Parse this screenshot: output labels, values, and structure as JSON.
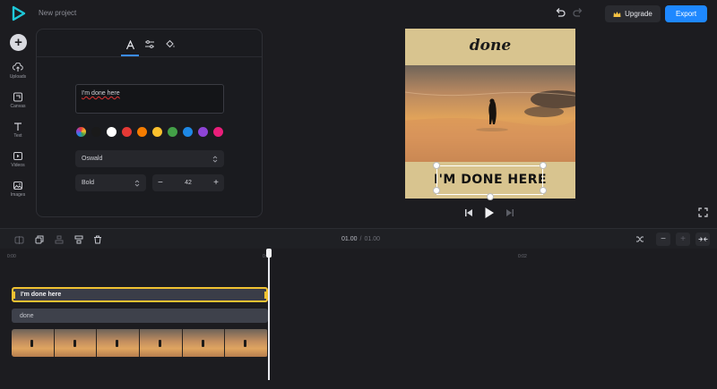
{
  "header": {
    "project_title": "New project",
    "upgrade_label": "Upgrade",
    "export_label": "Export",
    "accent_color": "#1e88ff"
  },
  "sidebar": {
    "items": [
      {
        "label": "Uploads",
        "icon": "upload-cloud-icon"
      },
      {
        "label": "Canvas",
        "icon": "canvas-icon"
      },
      {
        "label": "Text",
        "icon": "text-icon"
      },
      {
        "label": "Videos",
        "icon": "video-icon"
      },
      {
        "label": "Images",
        "icon": "image-icon"
      }
    ]
  },
  "text_panel": {
    "tabs": [
      {
        "icon": "text-format-icon",
        "active": true
      },
      {
        "icon": "sliders-icon",
        "active": false
      },
      {
        "icon": "paint-bucket-icon",
        "active": false
      }
    ],
    "text_value": "I'm done here",
    "colors": [
      "#1a1a1a",
      "#ffffff",
      "#e53935",
      "#f57c00",
      "#fbc02d",
      "#43a047",
      "#1e88e5",
      "#8e44d6",
      "#e91e7a"
    ],
    "font": "Oswald",
    "weight": "Bold",
    "size": "42"
  },
  "canvas": {
    "title": "done",
    "caption": "I'M DONE HERE",
    "background": "#d8c48f"
  },
  "timeline": {
    "current_time": "01.00",
    "total_time": "01.00",
    "ruler": [
      "0:00",
      "0:01",
      "0:02"
    ],
    "tracks": {
      "text_clip": "I'm done here",
      "label_clip": "done"
    }
  }
}
